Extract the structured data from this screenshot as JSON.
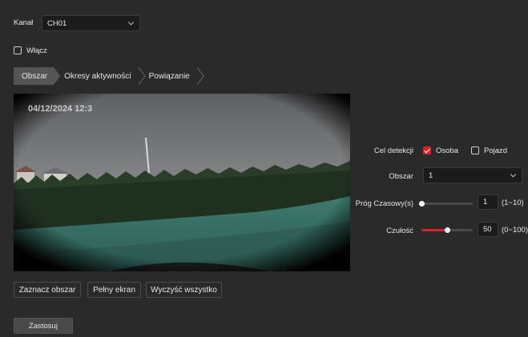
{
  "channel": {
    "label": "Kanał",
    "value": "CH01"
  },
  "enable": {
    "label": "Włącz",
    "checked": false
  },
  "tabs": [
    {
      "label": "Obszar",
      "active": true
    },
    {
      "label": "Okresy aktywności",
      "active": false
    },
    {
      "label": "Powiązanie",
      "active": false
    }
  ],
  "video": {
    "timestamp": "04/12/2024  12:3"
  },
  "detection": {
    "label": "Cel detekcji",
    "person": {
      "label": "Osoba",
      "checked": true
    },
    "vehicle": {
      "label": "Pojazd",
      "checked": false
    }
  },
  "area": {
    "label": "Obszar",
    "value": "1"
  },
  "threshold": {
    "label": "Próg Czasowy(s)",
    "value": "1",
    "range": "(1~10)",
    "level": 0
  },
  "sensitivity": {
    "label": "Czułość",
    "value": "50",
    "range": "(0~100)",
    "level": 0.5
  },
  "buttons": {
    "mark_area": "Zaznacz obszar",
    "fullscreen": "Pełny ekran",
    "clear_all": "Wyczyść wszystko",
    "apply": "Zastosuj"
  },
  "colors": {
    "accent": "#d8232a",
    "background": "#2a2a2a",
    "active_tab": "#555555"
  }
}
